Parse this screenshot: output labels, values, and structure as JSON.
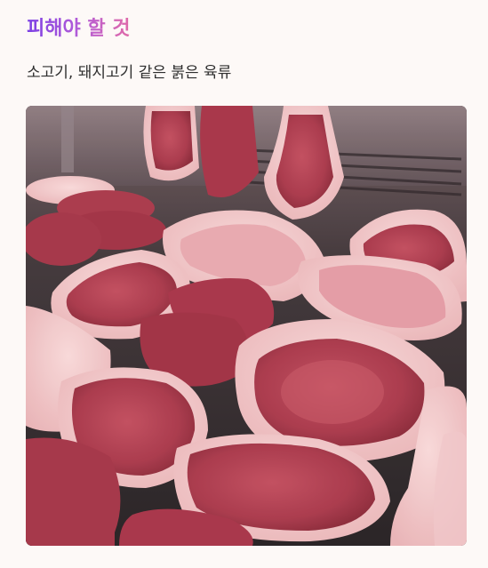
{
  "heading": {
    "title": "피해야 할 것"
  },
  "body": {
    "text": "소고기, 돼지고기 같은 붉은 육류"
  },
  "image": {
    "subject": "raw-red-meat-cuts-photo"
  },
  "colors": {
    "title_gradient": [
      "#7b3fe4",
      "#b35cd8",
      "#e06aa8"
    ],
    "text": "#2e2e2e",
    "background": "#fdf9f7"
  }
}
